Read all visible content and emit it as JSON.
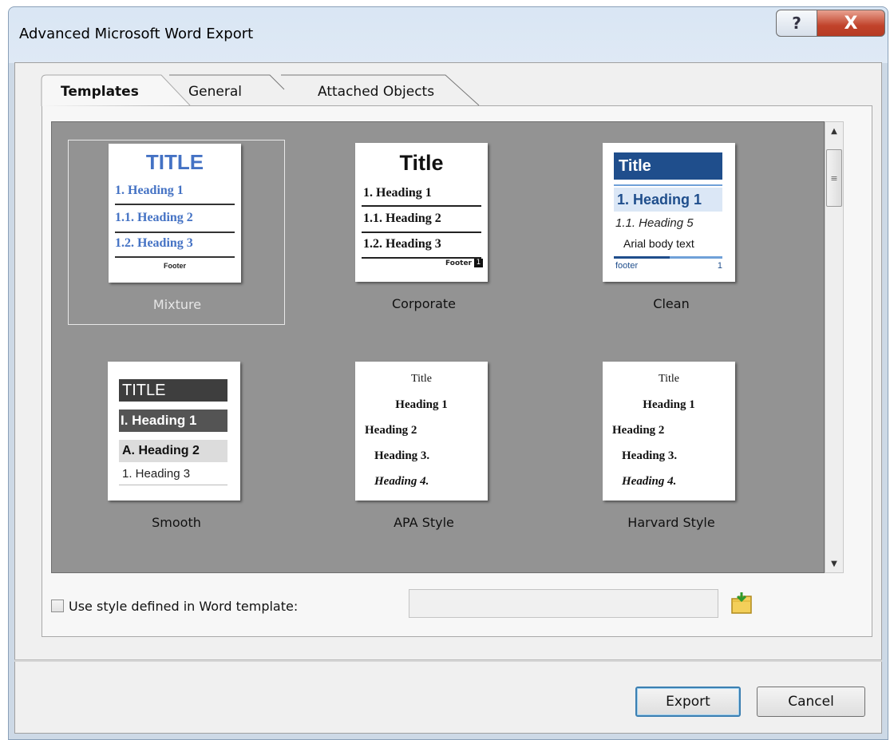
{
  "window": {
    "title": "Advanced Microsoft Word Export",
    "help_label": "?",
    "close_label": "X"
  },
  "tabs": [
    {
      "label": "Templates",
      "active": true
    },
    {
      "label": "General",
      "active": false
    },
    {
      "label": "Attached Objects",
      "active": false
    }
  ],
  "templates": [
    {
      "name": "Mixture",
      "selected": true,
      "preview": {
        "title": "TITLE",
        "h1": "1. Heading 1",
        "h2": "1.1. Heading 2",
        "h3": "1.2. Heading 3",
        "footer": "Footer"
      }
    },
    {
      "name": "Corporate",
      "selected": false,
      "preview": {
        "title": "Title",
        "h1": "1. Heading 1",
        "h2": "1.1. Heading 2",
        "h3": "1.2. Heading 3",
        "footer": "Footer",
        "page": "1"
      }
    },
    {
      "name": "Clean",
      "selected": false,
      "preview": {
        "title": "Title",
        "h1": "1. Heading 1",
        "h2": "1.1. Heading 5",
        "body": "Arial body text",
        "footer": "footer",
        "page": "1"
      }
    },
    {
      "name": "Smooth",
      "selected": false,
      "preview": {
        "title": "TITLE",
        "h1": "I. Heading 1",
        "h2": "A. Heading 2",
        "h3": "1. Heading 3"
      }
    },
    {
      "name": "APA Style",
      "selected": false,
      "preview": {
        "title": "Title",
        "h1": "Heading 1",
        "h2": "Heading 2",
        "h3": "Heading 3.",
        "h4": "Heading 4."
      }
    },
    {
      "name": "Harvard Style",
      "selected": false,
      "preview": {
        "title": "Title",
        "h1": "Heading 1",
        "h2": "Heading 2",
        "h3": "Heading 3.",
        "h4": "Heading 4."
      }
    }
  ],
  "use_template": {
    "label": "Use style defined in Word template:",
    "checked": false,
    "path_value": ""
  },
  "buttons": {
    "export": "Export",
    "cancel": "Cancel"
  },
  "colors": {
    "gallery_bg": "#939393",
    "mixture_blue": "#4472c4",
    "clean_navy": "#1f4e8c",
    "close_red": "#c1432b"
  }
}
